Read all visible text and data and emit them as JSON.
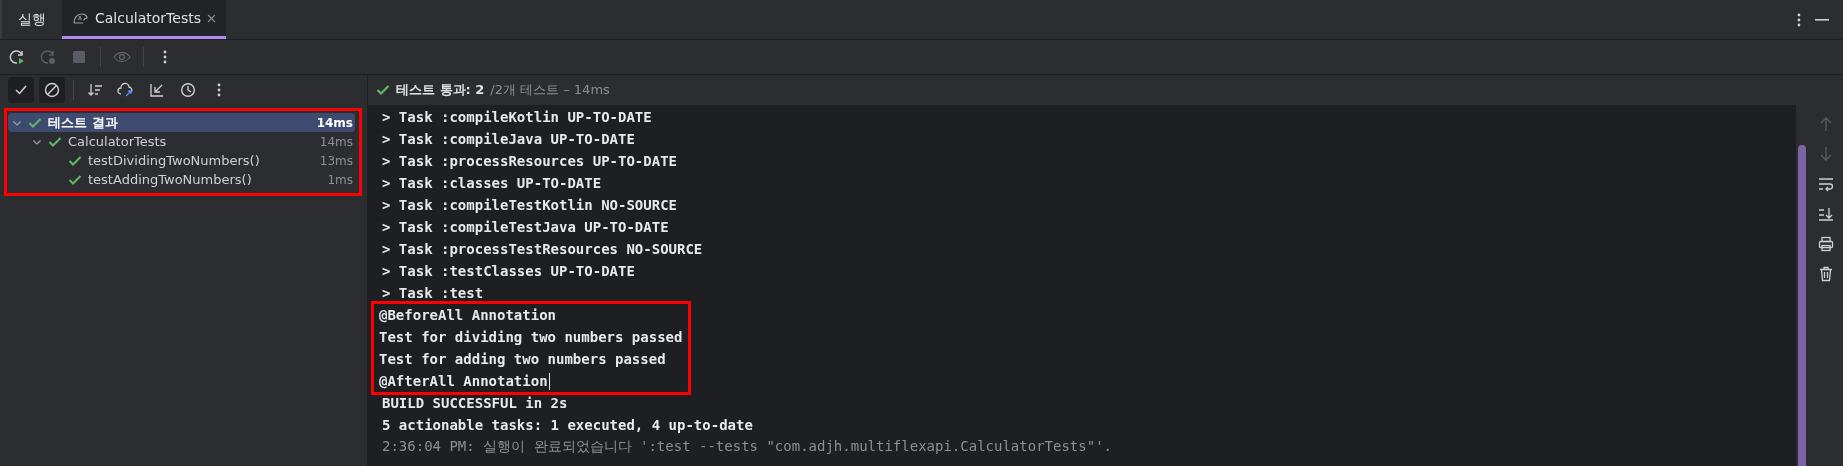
{
  "tool_window": {
    "title": "실행",
    "tabs": [
      {
        "label": "CalculatorTests",
        "selected": true
      }
    ]
  },
  "run_toolbar": [
    {
      "kind": "rerun",
      "disabled": false
    },
    {
      "kind": "rerun-failed",
      "disabled": true
    },
    {
      "kind": "stop",
      "disabled": true
    },
    {
      "kind": "separator"
    },
    {
      "kind": "eye",
      "disabled": true
    },
    {
      "kind": "separator"
    },
    {
      "kind": "more",
      "disabled": false
    }
  ],
  "test_toolbar": [
    {
      "kind": "show-passed",
      "on": true
    },
    {
      "kind": "show-ignored",
      "on": true
    },
    {
      "kind": "separator"
    },
    {
      "kind": "sort",
      "on": false
    },
    {
      "kind": "import",
      "on": false
    },
    {
      "kind": "collapse",
      "on": false
    },
    {
      "kind": "history",
      "on": false
    },
    {
      "kind": "more",
      "on": false
    }
  ],
  "status": {
    "success": true,
    "passed": "테스트 통과: 2",
    "total": "/2개 테스트 – 14ms"
  },
  "tree": {
    "highlighted": true,
    "items": [
      {
        "name": "테스트 결과",
        "duration": "14ms",
        "passed": true,
        "selected": true,
        "expanded": true,
        "children": [
          {
            "name": "CalculatorTests",
            "duration": "14ms",
            "passed": true,
            "selected": false,
            "expanded": true,
            "children": [
              {
                "name": "testDividingTwoNumbers()",
                "duration": "13ms",
                "passed": true,
                "selected": false
              },
              {
                "name": "testAddingTwoNumbers()",
                "duration": "1ms",
                "passed": true,
                "selected": false
              }
            ]
          }
        ]
      }
    ]
  },
  "console": {
    "lines": [
      {
        "text": "> Task :compileKotlin UP-TO-DATE",
        "kind": "output",
        "highlighted": false,
        "caret": false
      },
      {
        "text": "> Task :compileJava UP-TO-DATE",
        "kind": "output",
        "highlighted": false,
        "caret": false
      },
      {
        "text": "> Task :processResources UP-TO-DATE",
        "kind": "output",
        "highlighted": false,
        "caret": false
      },
      {
        "text": "> Task :classes UP-TO-DATE",
        "kind": "output",
        "highlighted": false,
        "caret": false
      },
      {
        "text": "> Task :compileTestKotlin NO-SOURCE",
        "kind": "output",
        "highlighted": false,
        "caret": false
      },
      {
        "text": "> Task :compileTestJava UP-TO-DATE",
        "kind": "output",
        "highlighted": false,
        "caret": false
      },
      {
        "text": "> Task :processTestResources NO-SOURCE",
        "kind": "output",
        "highlighted": false,
        "caret": false
      },
      {
        "text": "> Task :testClasses UP-TO-DATE",
        "kind": "output",
        "highlighted": false,
        "caret": false
      },
      {
        "text": "> Task :test",
        "kind": "output",
        "highlighted": false,
        "caret": false
      },
      {
        "text": "@BeforeAll Annotation",
        "kind": "output",
        "highlighted": true,
        "caret": false
      },
      {
        "text": "Test for dividing two numbers passed",
        "kind": "output",
        "highlighted": true,
        "caret": false
      },
      {
        "text": "Test for adding two numbers passed",
        "kind": "output",
        "highlighted": true,
        "caret": false
      },
      {
        "text": "@AfterAll Annotation",
        "kind": "output",
        "highlighted": true,
        "caret": true
      },
      {
        "text": "BUILD SUCCESSFUL in 2s",
        "kind": "output",
        "highlighted": false,
        "caret": false
      },
      {
        "text": "5 actionable tasks: 1 executed, 4 up-to-date",
        "kind": "output",
        "highlighted": false,
        "caret": false
      },
      {
        "text": "2:36:04 PM: 실행이 완료되었습니다 ':test --tests \"com.adjh.multiflexapi.CalculatorTests\"'.",
        "kind": "info",
        "highlighted": false,
        "caret": false
      }
    ]
  },
  "side_tools": [
    {
      "kind": "up",
      "disabled": true
    },
    {
      "kind": "down",
      "disabled": true
    },
    {
      "kind": "soft-wrap",
      "disabled": false
    },
    {
      "kind": "scroll-end",
      "disabled": false
    },
    {
      "kind": "print",
      "disabled": false
    },
    {
      "kind": "clear",
      "disabled": false
    }
  ]
}
